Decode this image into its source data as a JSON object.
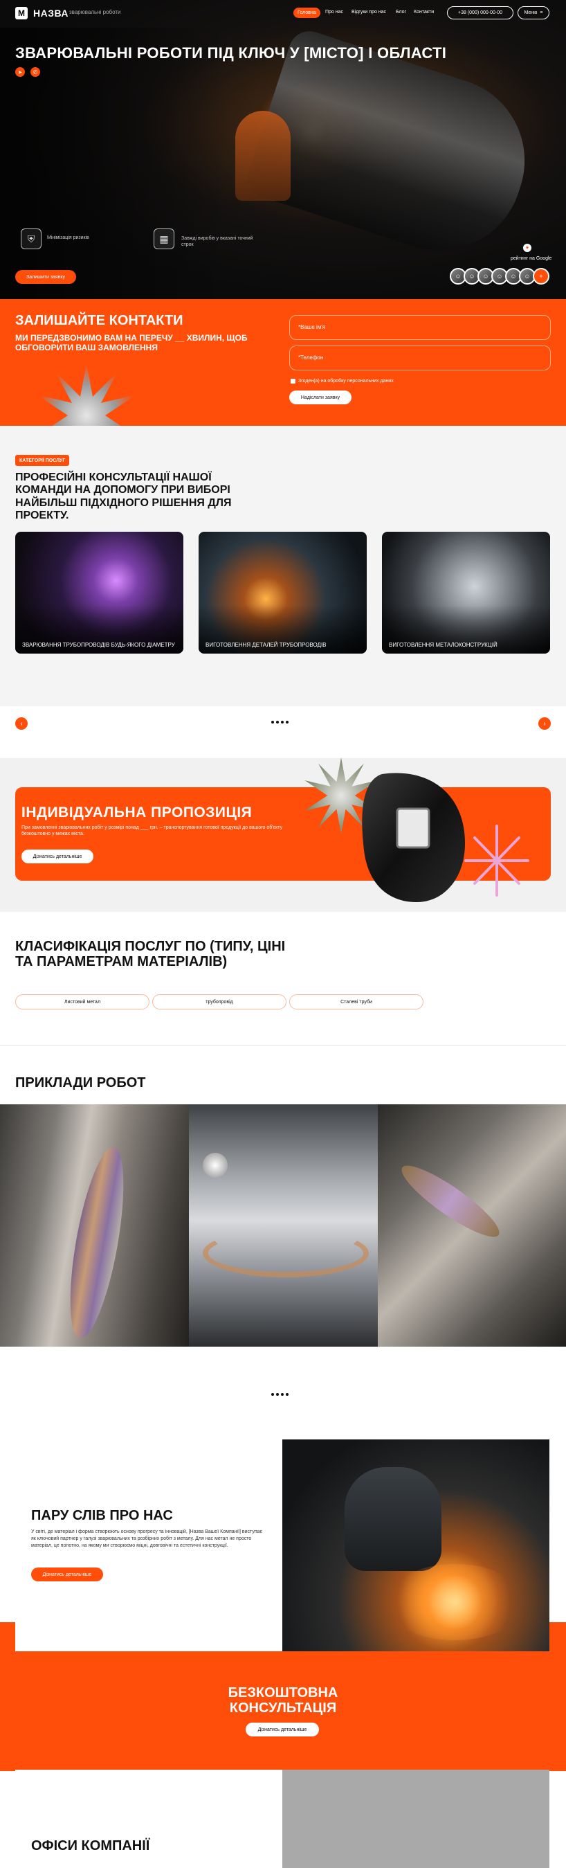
{
  "header": {
    "logo_mark": "M",
    "brand": "НАЗВА",
    "tagline": "зварювальні роботи",
    "nav": [
      "Головна",
      "Про нас",
      "Відгуки про нас",
      "Блог",
      "Контакти"
    ],
    "phone": "+38 (000) 000-00-00",
    "menu_label": "Меню"
  },
  "hero": {
    "title": "ЗВАРЮВАЛЬНІ РОБОТИ ПІД КЛЮЧ У [МІСТО] І ОБЛАСТІ",
    "features": [
      "Мінімізація ризиків",
      "Завжді виробів у вказані точний строк"
    ],
    "cta": "Залишити заявку",
    "rating_label": "рейтинг на Google",
    "avatars_more": "+"
  },
  "contact": {
    "title": "ЗАЛИШАЙТЕ КОНТАКТИ",
    "subtitle": "МИ ПЕРЕДЗВОНИМО ВАМ НА ПЕРЕЧУ __ ХВИЛИН, ЩОБ ОБГОВОРИТИ ВАШ ЗАМОВЛЕННЯ",
    "name_placeholder": "*Ваше ім'я",
    "phone_placeholder": "*Телефон",
    "consent": "Згоден(а) на обробку персональних даних",
    "submit": "Надіслати заявку"
  },
  "services": {
    "badge": "КАТЕГОРІЇ ПОСЛУГ",
    "title": "ПРОФЕСІЙНІ КОНСУЛЬТАЦІЇ НАШОЇ КОМАНДИ НА ДОПОМОГУ ПРИ ВИБОРІ НАЙБІЛЬШ ПІДХІДНОГО РІШЕННЯ ДЛЯ ПРОЕКТУ.",
    "cards": [
      "ЗВАРЮВАННЯ ТРУБОПРОВОДІВ БУДЬ-ЯКОГО ДІАМЕТРУ",
      "ВИГОТОВЛЕННЯ ДЕТАЛЕЙ ТРУБОПРОВОДІВ",
      "ВИГОТОВЛЕННЯ МЕТАЛОКОНСТРУКЦІЙ"
    ],
    "prev": "‹",
    "next": "›"
  },
  "offer": {
    "title": "ІНДИВІДУАЛЬНА ПРОПОЗИЦІЯ",
    "text": "При замовленні зварювальних робіт у розмірі понад ___ грн. – транспортування готової продукції до вашого об'єкту безкоштовно у межах міста.",
    "button": "Дізнатись детальніше"
  },
  "classification": {
    "title": "КЛАСИФІКАЦІЯ ПОСЛУГ ПО (ТИПУ, ЦІНІ ТА ПАРАМЕТРАМ МАТЕРІАЛІВ)",
    "chips": [
      "Листовий метал",
      "трубопровід",
      "Сталеві труби"
    ]
  },
  "examples": {
    "title": "ПРИКЛАДИ РОБОТ"
  },
  "about": {
    "title": "ПАРУ СЛІВ ПРО НАС",
    "text": "У світі, де матеріал і форма створюють основу прогресу та інновацій, [Назва Вашої Компанії] виступає як ключовий партнер у галузі зварювальних та розбірних робіт з металу. Для нас метал не просто матеріал, це полотно, на якому ми створюємо міцні, довговічні та естетичні конструкції.",
    "button": "Дізнатись детальніше"
  },
  "consult": {
    "title_line1": "БЕЗКОШТОВНА",
    "title_line2": "КОНСУЛЬТАЦІЯ",
    "button": "Дізнатись детальніше"
  },
  "offices": {
    "title": "ОФІСИ КОМПАНІЇ"
  },
  "colors": {
    "accent": "#ff4d0a",
    "dark": "#111111",
    "light_bg": "#f4f4f4"
  }
}
